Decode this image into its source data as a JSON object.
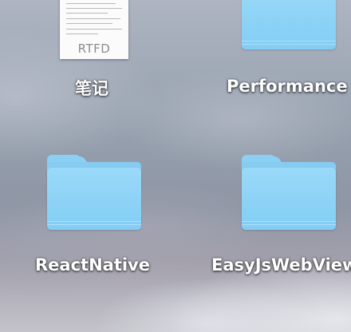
{
  "desktop": {
    "items": [
      {
        "label": "笔记",
        "icon": "rtfd-document-icon",
        "badge": "RTFD"
      },
      {
        "label": "Performance",
        "icon": "folder-icon"
      },
      {
        "label": "ReactNative",
        "icon": "folder-icon"
      },
      {
        "label": "EasyJsWebView",
        "icon": "folder-icon"
      }
    ]
  },
  "colors": {
    "folder_front": "#82cdf5",
    "folder_back": "#86ccf0",
    "label_text": "#ffffff"
  }
}
